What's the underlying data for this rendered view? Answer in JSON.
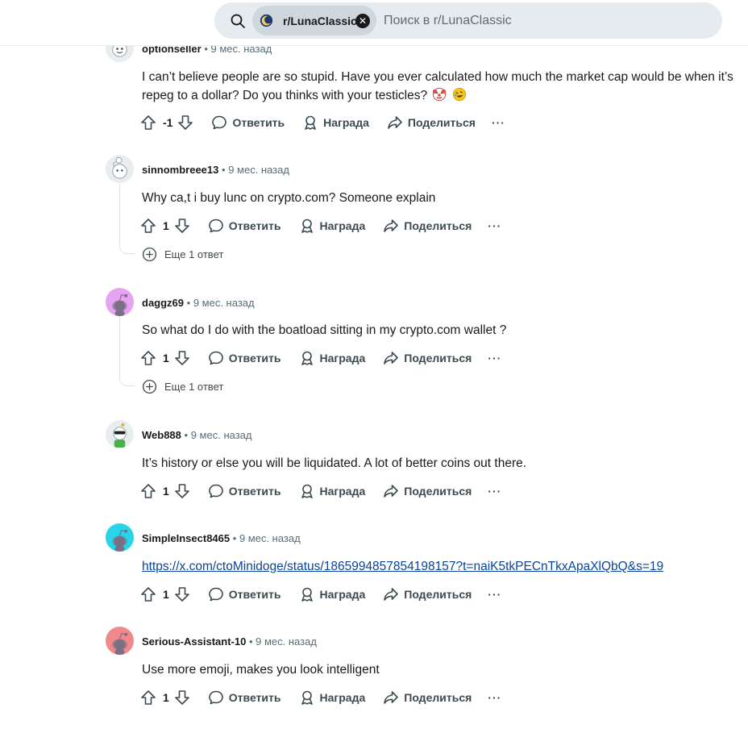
{
  "search": {
    "chip_label": "r/LunaClassic",
    "placeholder": "Поиск в r/LunaClassic"
  },
  "colors": {
    "link": "#0a449b",
    "chip_bg": "#cfd7dd",
    "search_bg": "#e5ebee",
    "avatar_pink": "#e7a2f2",
    "avatar_cyan": "#28d4e8",
    "avatar_red": "#f08a8a"
  },
  "labels": {
    "reply": "Ответить",
    "award": "Награда",
    "share": "Поделиться",
    "more": "···",
    "dot": "•"
  },
  "comments": [
    {
      "user": "optionseller",
      "time": "9 мес. назад",
      "text": "I can’t believe people are so stupid. Have you ever calculated how much the market cap would be when it’s repeg to a dollar? Do you thinks with your testicles?",
      "emojis": [
        "clown-face-icon",
        "rofl-face-icon"
      ],
      "score": "-1"
    },
    {
      "user": "sinnombreee13",
      "time": "9 мес. назад",
      "text": "Why ca,t i buy lunc on crypto.com? Someone explain",
      "score": "1",
      "more_replies": "Еще 1 ответ"
    },
    {
      "user": "daggz69",
      "time": "9 мес. назад",
      "text": "So what do I do with the boatload sitting in my crypto.com wallet ?",
      "score": "1",
      "more_replies": "Еще 1 ответ"
    },
    {
      "user": "Web888",
      "time": "9 мес. назад",
      "text": "It’s history or else you will be liquidated. A lot of better coins out there.",
      "score": "1"
    },
    {
      "user": "SimpleInsect8465",
      "time": "9 мес. назад",
      "link": "https://x.com/ctoMinidoge/status/1865994857854198157?t=naiK5tkPECnTkxApaXlQbQ&s=19",
      "score": "1"
    },
    {
      "user": "Serious-Assistant-10",
      "time": "9 мес. назад",
      "text": "Use more emoji, makes you look intelligent",
      "score": "1"
    }
  ]
}
